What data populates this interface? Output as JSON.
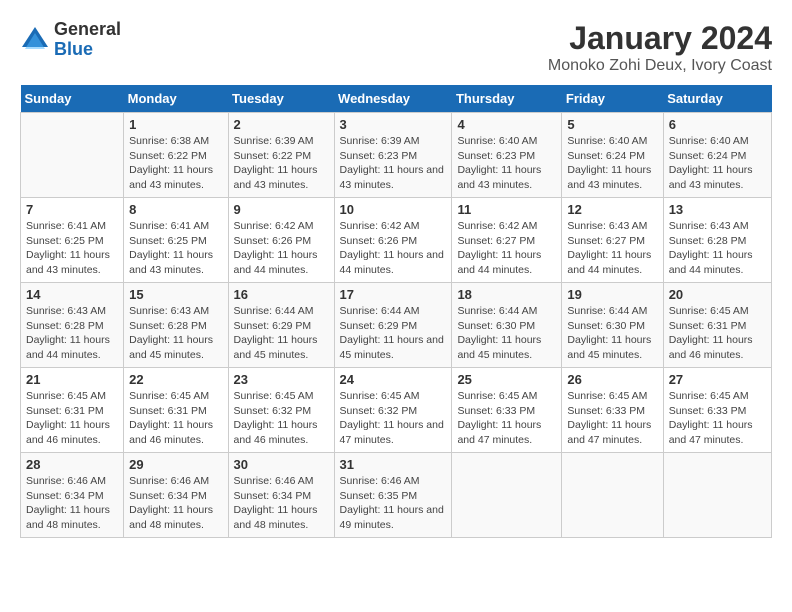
{
  "logo": {
    "general": "General",
    "blue": "Blue"
  },
  "title": "January 2024",
  "subtitle": "Monoko Zohi Deux, Ivory Coast",
  "headers": [
    "Sunday",
    "Monday",
    "Tuesday",
    "Wednesday",
    "Thursday",
    "Friday",
    "Saturday"
  ],
  "weeks": [
    [
      {
        "day": "",
        "sunrise": "",
        "sunset": "",
        "daylight": ""
      },
      {
        "day": "1",
        "sunrise": "Sunrise: 6:38 AM",
        "sunset": "Sunset: 6:22 PM",
        "daylight": "Daylight: 11 hours and 43 minutes."
      },
      {
        "day": "2",
        "sunrise": "Sunrise: 6:39 AM",
        "sunset": "Sunset: 6:22 PM",
        "daylight": "Daylight: 11 hours and 43 minutes."
      },
      {
        "day": "3",
        "sunrise": "Sunrise: 6:39 AM",
        "sunset": "Sunset: 6:23 PM",
        "daylight": "Daylight: 11 hours and 43 minutes."
      },
      {
        "day": "4",
        "sunrise": "Sunrise: 6:40 AM",
        "sunset": "Sunset: 6:23 PM",
        "daylight": "Daylight: 11 hours and 43 minutes."
      },
      {
        "day": "5",
        "sunrise": "Sunrise: 6:40 AM",
        "sunset": "Sunset: 6:24 PM",
        "daylight": "Daylight: 11 hours and 43 minutes."
      },
      {
        "day": "6",
        "sunrise": "Sunrise: 6:40 AM",
        "sunset": "Sunset: 6:24 PM",
        "daylight": "Daylight: 11 hours and 43 minutes."
      }
    ],
    [
      {
        "day": "7",
        "sunrise": "Sunrise: 6:41 AM",
        "sunset": "Sunset: 6:25 PM",
        "daylight": "Daylight: 11 hours and 43 minutes."
      },
      {
        "day": "8",
        "sunrise": "Sunrise: 6:41 AM",
        "sunset": "Sunset: 6:25 PM",
        "daylight": "Daylight: 11 hours and 43 minutes."
      },
      {
        "day": "9",
        "sunrise": "Sunrise: 6:42 AM",
        "sunset": "Sunset: 6:26 PM",
        "daylight": "Daylight: 11 hours and 44 minutes."
      },
      {
        "day": "10",
        "sunrise": "Sunrise: 6:42 AM",
        "sunset": "Sunset: 6:26 PM",
        "daylight": "Daylight: 11 hours and 44 minutes."
      },
      {
        "day": "11",
        "sunrise": "Sunrise: 6:42 AM",
        "sunset": "Sunset: 6:27 PM",
        "daylight": "Daylight: 11 hours and 44 minutes."
      },
      {
        "day": "12",
        "sunrise": "Sunrise: 6:43 AM",
        "sunset": "Sunset: 6:27 PM",
        "daylight": "Daylight: 11 hours and 44 minutes."
      },
      {
        "day": "13",
        "sunrise": "Sunrise: 6:43 AM",
        "sunset": "Sunset: 6:28 PM",
        "daylight": "Daylight: 11 hours and 44 minutes."
      }
    ],
    [
      {
        "day": "14",
        "sunrise": "Sunrise: 6:43 AM",
        "sunset": "Sunset: 6:28 PM",
        "daylight": "Daylight: 11 hours and 44 minutes."
      },
      {
        "day": "15",
        "sunrise": "Sunrise: 6:43 AM",
        "sunset": "Sunset: 6:28 PM",
        "daylight": "Daylight: 11 hours and 45 minutes."
      },
      {
        "day": "16",
        "sunrise": "Sunrise: 6:44 AM",
        "sunset": "Sunset: 6:29 PM",
        "daylight": "Daylight: 11 hours and 45 minutes."
      },
      {
        "day": "17",
        "sunrise": "Sunrise: 6:44 AM",
        "sunset": "Sunset: 6:29 PM",
        "daylight": "Daylight: 11 hours and 45 minutes."
      },
      {
        "day": "18",
        "sunrise": "Sunrise: 6:44 AM",
        "sunset": "Sunset: 6:30 PM",
        "daylight": "Daylight: 11 hours and 45 minutes."
      },
      {
        "day": "19",
        "sunrise": "Sunrise: 6:44 AM",
        "sunset": "Sunset: 6:30 PM",
        "daylight": "Daylight: 11 hours and 45 minutes."
      },
      {
        "day": "20",
        "sunrise": "Sunrise: 6:45 AM",
        "sunset": "Sunset: 6:31 PM",
        "daylight": "Daylight: 11 hours and 46 minutes."
      }
    ],
    [
      {
        "day": "21",
        "sunrise": "Sunrise: 6:45 AM",
        "sunset": "Sunset: 6:31 PM",
        "daylight": "Daylight: 11 hours and 46 minutes."
      },
      {
        "day": "22",
        "sunrise": "Sunrise: 6:45 AM",
        "sunset": "Sunset: 6:31 PM",
        "daylight": "Daylight: 11 hours and 46 minutes."
      },
      {
        "day": "23",
        "sunrise": "Sunrise: 6:45 AM",
        "sunset": "Sunset: 6:32 PM",
        "daylight": "Daylight: 11 hours and 46 minutes."
      },
      {
        "day": "24",
        "sunrise": "Sunrise: 6:45 AM",
        "sunset": "Sunset: 6:32 PM",
        "daylight": "Daylight: 11 hours and 47 minutes."
      },
      {
        "day": "25",
        "sunrise": "Sunrise: 6:45 AM",
        "sunset": "Sunset: 6:33 PM",
        "daylight": "Daylight: 11 hours and 47 minutes."
      },
      {
        "day": "26",
        "sunrise": "Sunrise: 6:45 AM",
        "sunset": "Sunset: 6:33 PM",
        "daylight": "Daylight: 11 hours and 47 minutes."
      },
      {
        "day": "27",
        "sunrise": "Sunrise: 6:45 AM",
        "sunset": "Sunset: 6:33 PM",
        "daylight": "Daylight: 11 hours and 47 minutes."
      }
    ],
    [
      {
        "day": "28",
        "sunrise": "Sunrise: 6:46 AM",
        "sunset": "Sunset: 6:34 PM",
        "daylight": "Daylight: 11 hours and 48 minutes."
      },
      {
        "day": "29",
        "sunrise": "Sunrise: 6:46 AM",
        "sunset": "Sunset: 6:34 PM",
        "daylight": "Daylight: 11 hours and 48 minutes."
      },
      {
        "day": "30",
        "sunrise": "Sunrise: 6:46 AM",
        "sunset": "Sunset: 6:34 PM",
        "daylight": "Daylight: 11 hours and 48 minutes."
      },
      {
        "day": "31",
        "sunrise": "Sunrise: 6:46 AM",
        "sunset": "Sunset: 6:35 PM",
        "daylight": "Daylight: 11 hours and 49 minutes."
      },
      {
        "day": "",
        "sunrise": "",
        "sunset": "",
        "daylight": ""
      },
      {
        "day": "",
        "sunrise": "",
        "sunset": "",
        "daylight": ""
      },
      {
        "day": "",
        "sunrise": "",
        "sunset": "",
        "daylight": ""
      }
    ]
  ]
}
